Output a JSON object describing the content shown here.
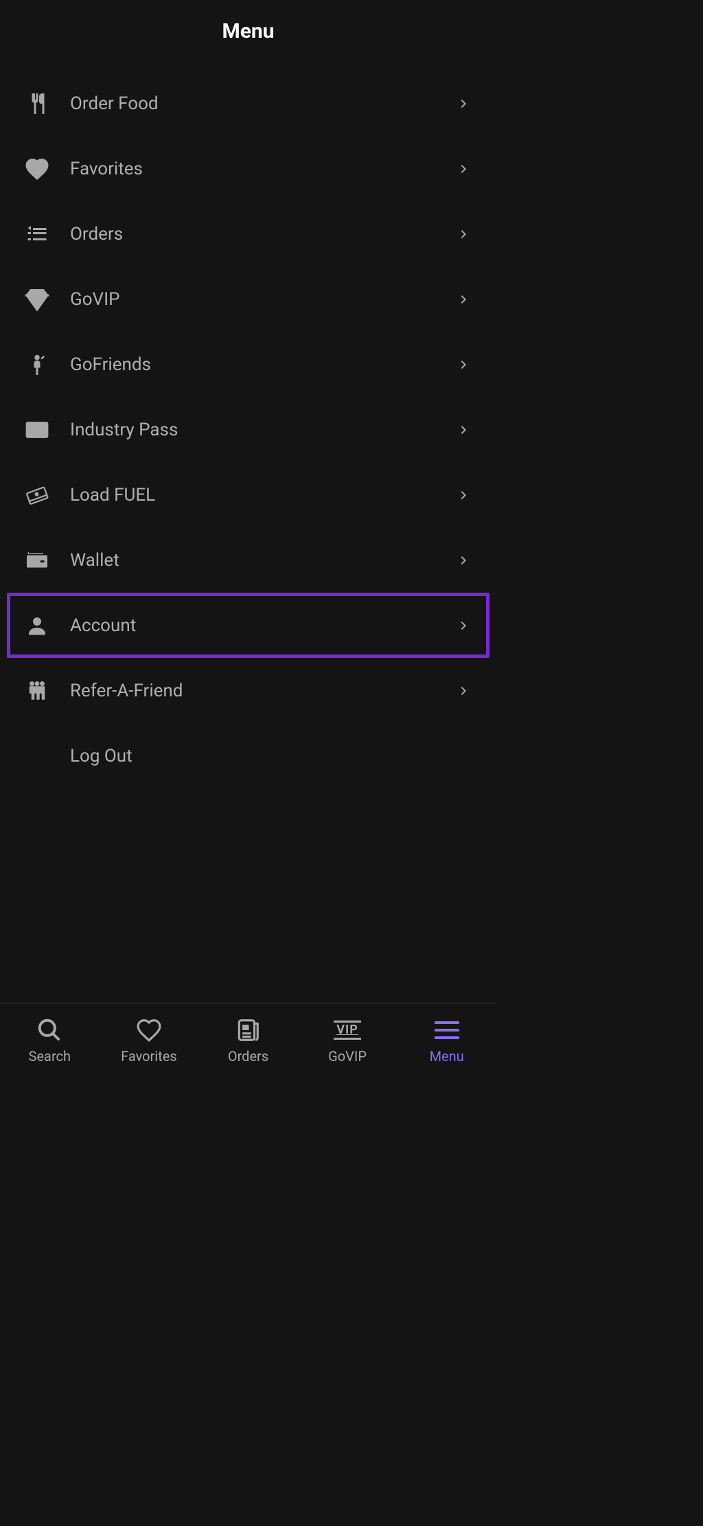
{
  "header": {
    "title": "Menu"
  },
  "menu": {
    "items": [
      {
        "id": "order-food",
        "label": "Order Food",
        "icon": "utensils-icon",
        "chevron": true
      },
      {
        "id": "favorites",
        "label": "Favorites",
        "icon": "heart-icon",
        "chevron": true
      },
      {
        "id": "orders",
        "label": "Orders",
        "icon": "list-icon",
        "chevron": true
      },
      {
        "id": "govip",
        "label": "GoVIP",
        "icon": "diamond-icon",
        "chevron": true
      },
      {
        "id": "gofriends",
        "label": "GoFriends",
        "icon": "person-wave-icon",
        "chevron": true
      },
      {
        "id": "industry-pass",
        "label": "Industry Pass",
        "icon": "id-card-icon",
        "chevron": true
      },
      {
        "id": "load-fuel",
        "label": "Load FUEL",
        "icon": "cash-stack-icon",
        "chevron": true
      },
      {
        "id": "wallet",
        "label": "Wallet",
        "icon": "wallet-icon",
        "chevron": true
      },
      {
        "id": "account",
        "label": "Account",
        "icon": "person-icon",
        "chevron": true,
        "highlighted": true
      },
      {
        "id": "refer-a-friend",
        "label": "Refer-A-Friend",
        "icon": "group-icon",
        "chevron": true
      },
      {
        "id": "log-out",
        "label": "Log Out",
        "icon": "",
        "chevron": false
      }
    ]
  },
  "bottomNav": {
    "items": [
      {
        "id": "search",
        "label": "Search",
        "icon": "search-icon"
      },
      {
        "id": "favorites",
        "label": "Favorites",
        "icon": "heart-icon"
      },
      {
        "id": "orders",
        "label": "Orders",
        "icon": "newspaper-icon"
      },
      {
        "id": "govip",
        "label": "GoVIP",
        "icon": "vip-icon"
      },
      {
        "id": "menu",
        "label": "Menu",
        "icon": "hamburger-icon",
        "active": true
      }
    ]
  }
}
